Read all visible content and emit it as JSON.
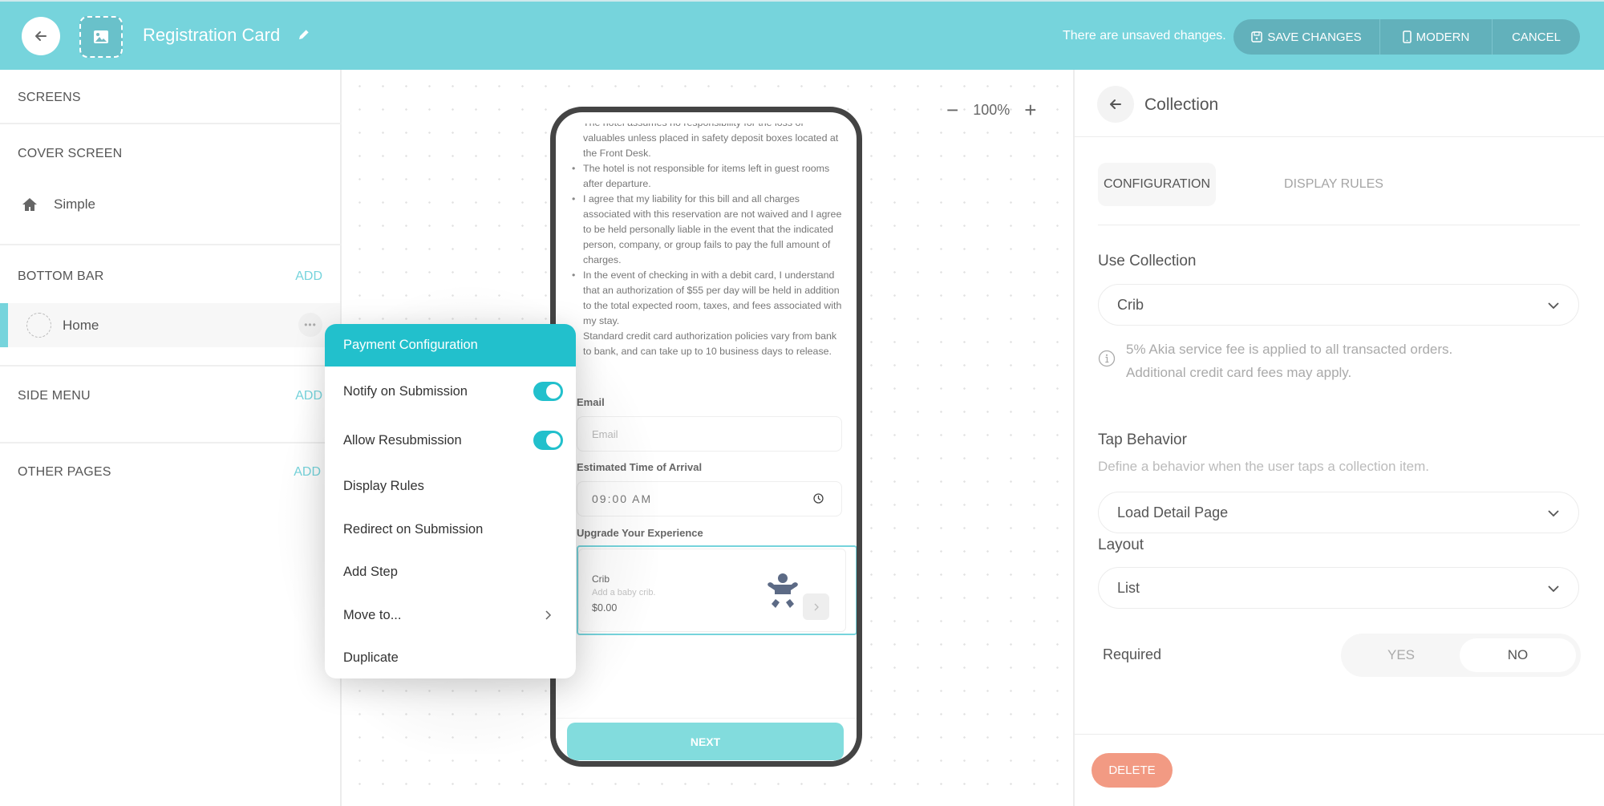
{
  "header": {
    "title": "Registration Card",
    "unsaved_text": "There are unsaved changes.",
    "buttons": {
      "save": "SAVE CHANGES",
      "modern": "MODERN",
      "cancel": "CANCEL"
    },
    "icons": {
      "back": "arrow-left-icon",
      "image": "image-placeholder-icon",
      "edit": "pencil-icon",
      "save": "floppy-disk-icon",
      "modern": "phone-icon"
    }
  },
  "sidebar": {
    "screens_label": "SCREENS",
    "cover_screen": {
      "label": "COVER SCREEN",
      "items": [
        {
          "label": "Simple",
          "icon": "home-icon"
        }
      ]
    },
    "bottom_bar": {
      "label": "BOTTOM BAR",
      "add": "ADD",
      "items": [
        {
          "label": "Home",
          "icon": "dashed-circle-icon",
          "selected": true
        }
      ]
    },
    "side_menu": {
      "label": "SIDE MENU",
      "add": "ADD"
    },
    "other_pages": {
      "label": "OTHER PAGES",
      "add": "ADD"
    }
  },
  "canvas": {
    "zoom_level": "100%",
    "zoom_out": "−",
    "zoom_in": "+"
  },
  "phone": {
    "terms_cut_line": "The hotel assumes no responsibility for the loss of",
    "terms": [
      "valuables unless placed in safety deposit boxes located at the Front Desk.",
      "The hotel is not responsible for items left in guest rooms after departure.",
      "I agree that my liability for this bill and all charges associated with this reservation are not waived and I agree to be held personally liable in the event that the indicated person, company, or group fails to pay the full amount of charges.",
      "In the event of checking in with a debit card, I understand that an authorization of $55 per day will be held in addition to the total expected room, taxes, and fees associated with my stay.",
      "Standard credit card authorization policies vary from bank to bank, and can take up to 10 business days to release."
    ],
    "email": {
      "label": "Email",
      "placeholder": "Email"
    },
    "eta": {
      "label": "Estimated Time of Arrival",
      "value": "09:00 AM"
    },
    "upgrade": {
      "label": "Upgrade Your Experience",
      "item": {
        "name": "Crib",
        "description": "Add a baby crib.",
        "price": "$0.00",
        "icon": "baby-icon"
      }
    },
    "next_button": "NEXT"
  },
  "context_menu": {
    "title": "Payment Configuration",
    "items": [
      {
        "label": "Notify on Submission",
        "type": "toggle",
        "on": true
      },
      {
        "label": "Allow Resubmission",
        "type": "toggle",
        "on": true
      },
      {
        "label": "Display Rules",
        "type": "action"
      },
      {
        "label": "Redirect on Submission",
        "type": "action"
      },
      {
        "label": "Add Step",
        "type": "action"
      },
      {
        "label": "Move to...",
        "type": "submenu"
      },
      {
        "label": "Duplicate",
        "type": "action"
      }
    ]
  },
  "right_panel": {
    "title": "Collection",
    "tabs": [
      {
        "label": "CONFIGURATION",
        "active": true
      },
      {
        "label": "DISPLAY RULES",
        "active": false
      }
    ],
    "use_collection": {
      "label": "Use Collection",
      "value": "Crib",
      "info_lines": [
        "5% Akia service fee is applied to all transacted orders.",
        "Additional credit card fees may apply."
      ]
    },
    "tap_behavior": {
      "label": "Tap Behavior",
      "help": "Define a behavior when the user taps a collection item.",
      "value": "Load Detail Page"
    },
    "layout": {
      "label": "Layout",
      "value": "List"
    },
    "required": {
      "label": "Required",
      "options": [
        "YES",
        "NO"
      ],
      "selected": "NO"
    },
    "delete_button": "DELETE"
  },
  "colors": {
    "brand_teal": "#76d4dc",
    "menu_teal": "#22c0cc",
    "delete": "#f29a83"
  }
}
